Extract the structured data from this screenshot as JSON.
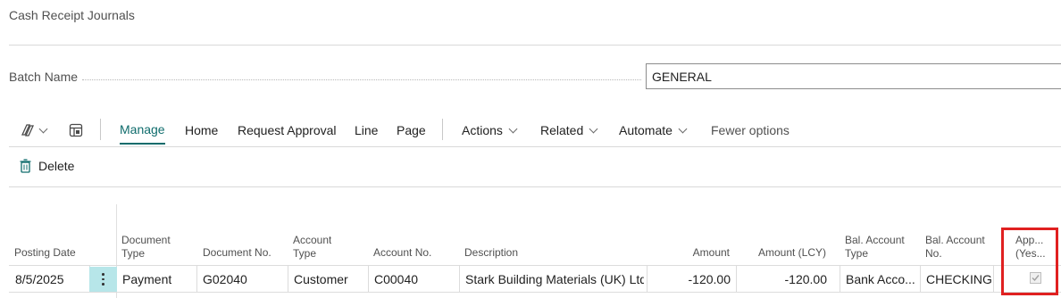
{
  "page": {
    "title": "Cash Receipt Journals"
  },
  "batch": {
    "label": "Batch Name",
    "value": "GENERAL"
  },
  "toolbar": {
    "items": [
      {
        "label": "Manage",
        "active": true
      },
      {
        "label": "Home"
      },
      {
        "label": "Request Approval"
      },
      {
        "label": "Line"
      },
      {
        "label": "Page"
      },
      {
        "label": "Actions",
        "dropdown": true
      },
      {
        "label": "Related",
        "dropdown": true
      },
      {
        "label": "Automate",
        "dropdown": true
      },
      {
        "label": "Fewer options"
      }
    ]
  },
  "actions": {
    "delete_label": "Delete"
  },
  "table": {
    "headers": {
      "posting_date": "Posting Date",
      "document_type_1": "Document",
      "document_type_2": "Type",
      "document_no": "Document No.",
      "account_type_1": "Account",
      "account_type_2": "Type",
      "account_no": "Account No.",
      "description": "Description",
      "amount": "Amount",
      "amount_lcy": "Amount (LCY)",
      "bal_account_type_1": "Bal. Account",
      "bal_account_type_2": "Type",
      "bal_account_no_1": "Bal. Account",
      "bal_account_no_2": "No.",
      "approval_1": "App...",
      "approval_2": "(Yes..."
    },
    "rows": [
      {
        "posting_date": "8/5/2025",
        "document_type": "Payment",
        "document_no": "G02040",
        "account_type": "Customer",
        "account_no": "C00040",
        "description": "Stark Building Materials (UK) Ltd",
        "amount": "-120.00",
        "amount_lcy": "-120.00",
        "bal_account_type": "Bank Acco...",
        "bal_account_no": "CHECKING",
        "approval_checked": true
      }
    ]
  },
  "colors": {
    "accent": "#0f6c6c",
    "row_handle": "#b7e6e9",
    "highlight": "#e02020"
  }
}
